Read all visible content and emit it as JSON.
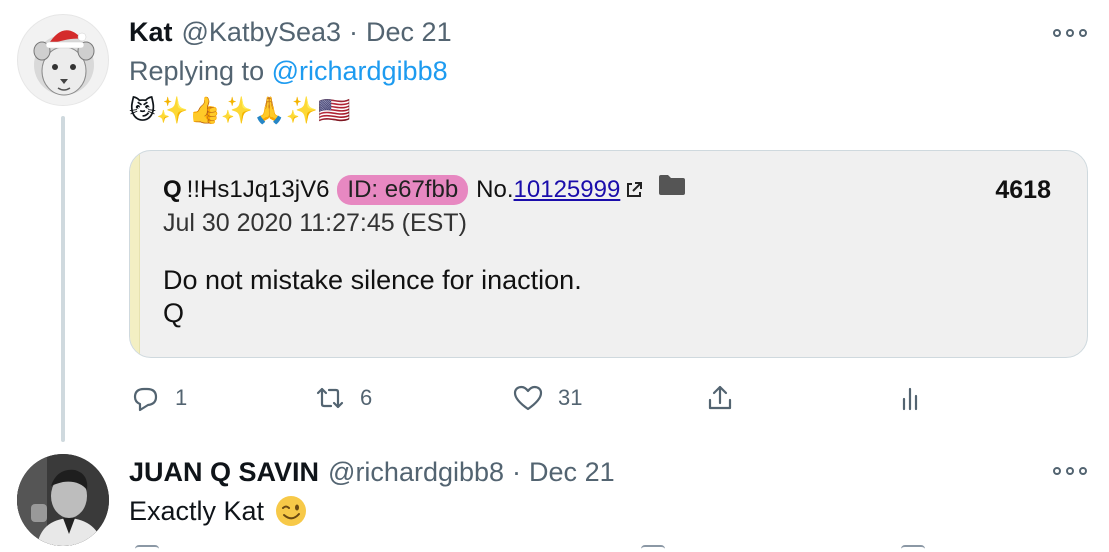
{
  "tweets": [
    {
      "name": "Kat",
      "handle": "@KatbySea3",
      "separator": "·",
      "date": "Dec 21",
      "replying_prefix": "Replying to",
      "replying_to": "@richardgibb8",
      "emoji_text": "😼✨👍✨🙏✨🇺🇸",
      "card": {
        "q": "Q",
        "trip": "!!Hs1Jq13jV6",
        "id_badge": "ID: e67fbb",
        "no_label": "No.",
        "post_number": "10125999",
        "post_count": "4618",
        "date": "Jul 30 2020 11:27:45 (EST)",
        "body_line1": "Do not mistake silence for inaction.",
        "body_line2": "Q"
      },
      "actions": {
        "replies": "1",
        "retweets": "6",
        "likes": "31"
      }
    },
    {
      "name": "JUAN Q SAVIN",
      "handle": "@richardgibb8",
      "separator": "·",
      "date": "Dec 21",
      "text": "Exactly Kat"
    }
  ],
  "colors": {
    "link": "#1d9bf0",
    "secondary_text": "#536471",
    "id_badge": "#e788c1",
    "card_bar": "#f3efc3"
  },
  "icons": [
    "more-icon",
    "reply-icon",
    "retweet-icon",
    "like-icon",
    "share-icon",
    "analytics-icon",
    "external-link-icon",
    "folder-icon",
    "wink-emoji-icon"
  ]
}
